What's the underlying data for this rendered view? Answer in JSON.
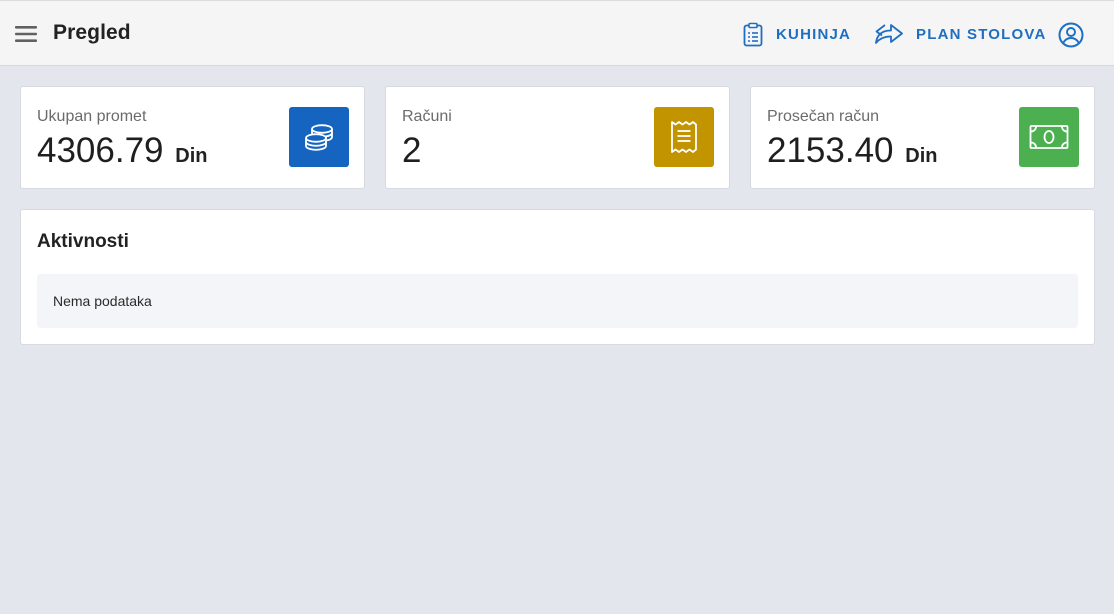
{
  "header": {
    "title": "Pregled",
    "nav": [
      {
        "label": "KUHINJA",
        "icon": "clipboard-list-icon"
      },
      {
        "label": "PLAN STOLOVA",
        "icon": "share-arrow-icon"
      }
    ],
    "account_icon": "account-circle-icon"
  },
  "stats": [
    {
      "label": "Ukupan promet",
      "value": "4306.79",
      "unit": "Din",
      "icon": "coins-icon",
      "color": "#1565c0"
    },
    {
      "label": "Računi",
      "value": "2",
      "unit": "",
      "icon": "receipt-icon",
      "color": "#c29400"
    },
    {
      "label": "Prosečan račun",
      "value": "2153.40",
      "unit": "Din",
      "icon": "cash-icon",
      "color": "#4caf50"
    }
  ],
  "activity": {
    "title": "Aktivnosti",
    "empty_text": "Nema podataka"
  },
  "colors": {
    "accent": "#1e6fc2",
    "background": "#e3e6ed",
    "topbar": "#f5f5f5"
  }
}
